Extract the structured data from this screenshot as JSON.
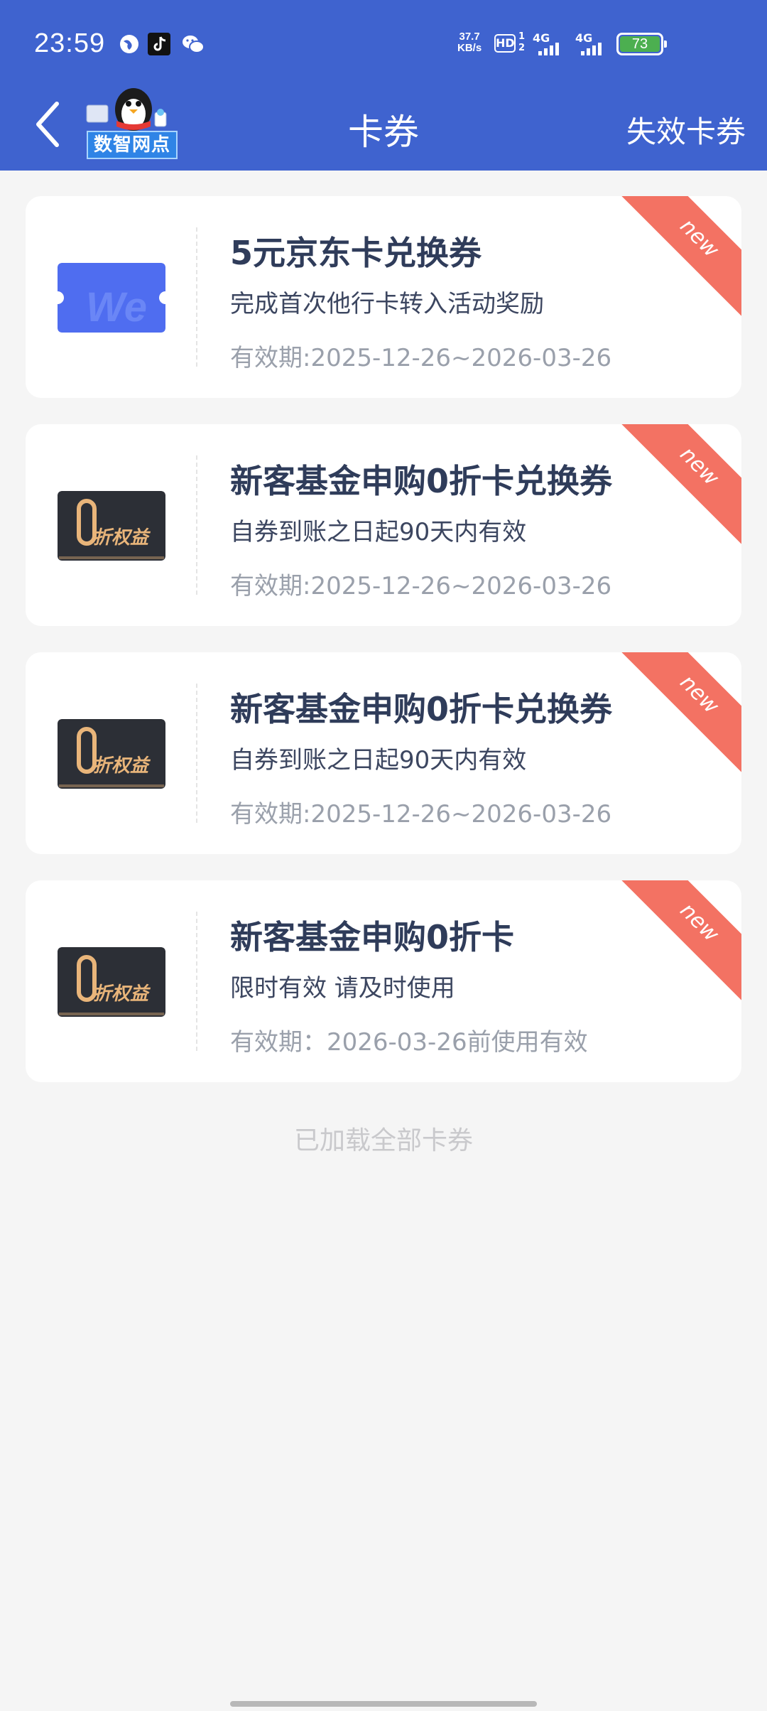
{
  "status_bar": {
    "time": "23:59",
    "net_speed_value": "37.7",
    "net_speed_unit": "KB/s",
    "hd": "HD",
    "sim_slots": "1\n2",
    "sim1_type": "4G",
    "sim2_type": "4G",
    "battery": "73",
    "icons": [
      "browser-icon",
      "tiktok-icon",
      "wechat-icon"
    ]
  },
  "header": {
    "title": "卡券",
    "logo_text": "数智网点",
    "invalid_label": "失效卡券",
    "background": "#3f63cf"
  },
  "coupons": [
    {
      "name": "5元京东卡兑换券",
      "desc": "完成首次他行卡转入活动奖励",
      "validity": "有效期:2025-12-26~2026-03-26",
      "badge": "new",
      "thumb": "jd-card-icon"
    },
    {
      "name": "新客基金申购0折卡兑换券",
      "desc": "自券到账之日起90天内有效",
      "validity": "有效期:2025-12-26~2026-03-26",
      "badge": "new",
      "thumb": "zero-discount-card-icon",
      "thumb_text": "折权益"
    },
    {
      "name": "新客基金申购0折卡兑换券",
      "desc": "自券到账之日起90天内有效",
      "validity": "有效期:2025-12-26~2026-03-26",
      "badge": "new",
      "thumb": "zero-discount-card-icon",
      "thumb_text": "折权益"
    },
    {
      "name": "新客基金申购0折卡",
      "desc": "限时有效 请及时使用",
      "validity": "有效期：2026-03-26前使用有效",
      "badge": "new",
      "thumb": "zero-discount-card-icon",
      "thumb_text": "折权益"
    }
  ],
  "footer": {
    "loaded_text": "已加载全部卡券"
  },
  "colors": {
    "header": "#3f63cf",
    "ribbon": "#f37263",
    "title_text": "#2f3c5a",
    "muted_text": "#9aa0ab"
  }
}
